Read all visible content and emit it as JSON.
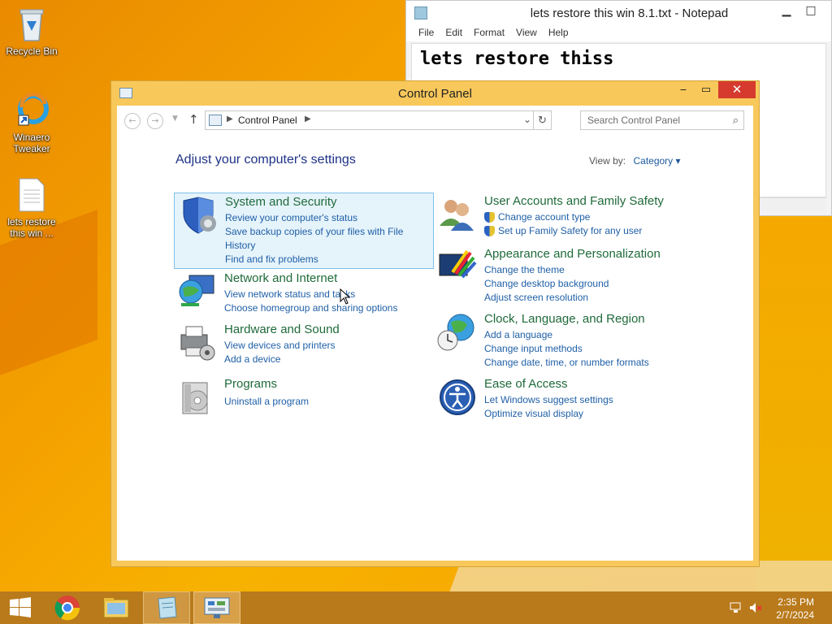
{
  "desktop": {
    "icons": [
      {
        "label": "Recycle Bin"
      },
      {
        "label": "Winaero Tweaker"
      },
      {
        "label": "lets restore this win ..."
      }
    ]
  },
  "notepad": {
    "title": "lets restore this win 8.1.txt - Notepad",
    "menu": [
      "File",
      "Edit",
      "Format",
      "View",
      "Help"
    ],
    "content": "lets restore thiss",
    "buttons": {
      "minimize": "▁",
      "maximize": "□"
    }
  },
  "control_panel": {
    "title": "Control Panel",
    "buttons": {
      "minimize": "‒",
      "maximize": "▭",
      "close": "✕"
    },
    "address": {
      "crumb": "Control Panel"
    },
    "search_placeholder": "Search Control Panel",
    "heading": "Adjust your computer's settings",
    "view_by_label": "View by:",
    "view_by_value": "Category",
    "categories": [
      {
        "title": "System and Security",
        "links": [
          "Review your computer's status",
          "Save backup copies of your files with File History",
          "Find and fix problems"
        ]
      },
      {
        "title": "Network and Internet",
        "links": [
          "View network status and tasks",
          "Choose homegroup and sharing options"
        ]
      },
      {
        "title": "Hardware and Sound",
        "links": [
          "View devices and printers",
          "Add a device"
        ]
      },
      {
        "title": "Programs",
        "links": [
          "Uninstall a program"
        ]
      },
      {
        "title": "User Accounts and Family Safety",
        "links": [
          "Change account type",
          "Set up Family Safety for any user"
        ]
      },
      {
        "title": "Appearance and Personalization",
        "links": [
          "Change the theme",
          "Change desktop background",
          "Adjust screen resolution"
        ]
      },
      {
        "title": "Clock, Language, and Region",
        "links": [
          "Add a language",
          "Change input methods",
          "Change date, time, or number formats"
        ]
      },
      {
        "title": "Ease of Access",
        "links": [
          "Let Windows suggest settings",
          "Optimize visual display"
        ]
      }
    ]
  },
  "taskbar": {
    "time": "2:35 PM",
    "date": "2/7/2024"
  },
  "colors": {
    "accent_orange": "#f5a300",
    "close_red": "#d63a2e",
    "link_blue": "#1f5fa6",
    "category_green": "#1f6a3a"
  }
}
